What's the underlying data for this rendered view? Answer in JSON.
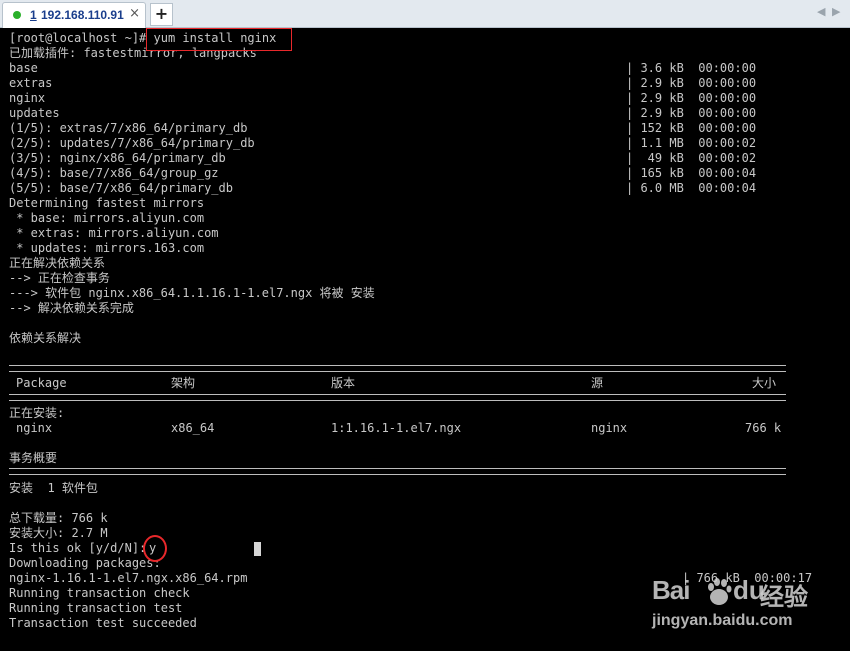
{
  "tab": {
    "number": "1",
    "title": "192.168.110.91",
    "close_glyph": "×"
  },
  "new_tab_glyph": "+",
  "nav": {
    "prev": "◀",
    "next": "▶"
  },
  "terminal": {
    "lines": [
      "[root@localhost ~]# yum install nginx",
      "已加载插件: fastestmirror, langpacks",
      "base",
      "extras",
      "nginx",
      "updates",
      "(1/5): extras/7/x86_64/primary_db",
      "(2/5): updates/7/x86_64/primary_db",
      "(3/5): nginx/x86_64/primary_db",
      "(4/5): base/7/x86_64/group_gz",
      "(5/5): base/7/x86_64/primary_db",
      "Determining fastest mirrors",
      " * base: mirrors.aliyun.com",
      " * extras: mirrors.aliyun.com",
      " * updates: mirrors.163.com",
      "正在解决依赖关系",
      "--> 正在检查事务",
      "---> 软件包 nginx.x86_64.1.1.16.1-1.el7.ngx 将被 安装",
      "--> 解决依赖关系完成",
      "",
      "依赖关系解决"
    ],
    "right_col": [
      "| 3.6 kB  00:00:00",
      "| 2.9 kB  00:00:00",
      "| 2.9 kB  00:00:00",
      "| 2.9 kB  00:00:00",
      "| 152 kB  00:00:00",
      "| 1.1 MB  00:00:02",
      "|  49 kB  00:00:02",
      "| 165 kB  00:00:04",
      "| 6.0 MB  00:00:04"
    ],
    "table": {
      "headers": [
        "Package",
        "架构",
        "版本",
        "源",
        "大小"
      ],
      "installing_label": "正在安装:",
      "row": [
        "nginx",
        "x86_64",
        "1:1.16.1-1.el7.ngx",
        "nginx",
        "766 k"
      ]
    },
    "summary_title": "事务概要",
    "install_summary": "安装  1 软件包",
    "total_download": "总下载量: 766 k",
    "install_size": "安装大小: 2.7 M",
    "prompt": "Is this ok [y/d/N]: ",
    "answer": "y",
    "tail": [
      "Downloading packages:",
      "nginx-1.16.1-1.el7.ngx.x86_64.rpm",
      "Running transaction check",
      "Running transaction test",
      "Transaction test succeeded"
    ],
    "rpm_progress": "| 766 kB  00:00:17"
  },
  "watermark": {
    "brand": "Bai",
    "brand2": "du",
    "product": "经验",
    "url": "jingyan.baidu.com"
  },
  "colors": {
    "text": "#c8c8c8",
    "highlight": "#e8282b",
    "tab_title": "#1a3e8c",
    "status_dot": "#2ab02a"
  }
}
